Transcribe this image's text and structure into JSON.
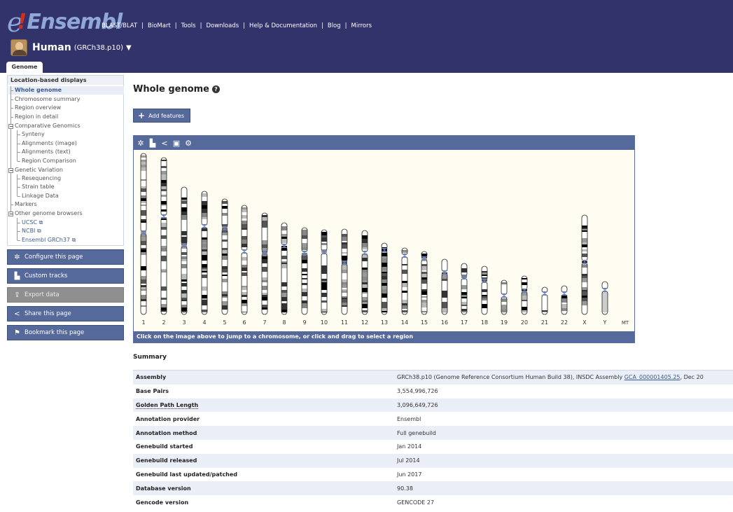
{
  "logo": {
    "e": "e",
    "bang": "!",
    "name": "Ensembl"
  },
  "top_links": [
    "BLAST/BLAT",
    "BioMart",
    "Tools",
    "Downloads",
    "Help & Documentation",
    "Blog",
    "Mirrors"
  ],
  "species": {
    "name": "Human",
    "assembly": "(GRCh38.p10)",
    "caret": "▼"
  },
  "tab": "Genome",
  "nav": {
    "header": "Location-based displays",
    "items": [
      "Whole genome",
      "Chromosome summary",
      "Region overview",
      "Region in detail",
      "Comparative Genomics",
      "Synteny",
      "Alignments (image)",
      "Alignments (text)",
      "Region Comparison",
      "Genetic Variation",
      "Resequencing",
      "Strain table",
      "Linkage Data",
      "Markers",
      "Other genome browsers",
      "UCSC",
      "NCBI",
      "Ensembl GRCh37"
    ]
  },
  "panel_buttons": [
    "Configure this page",
    "Custom tracks",
    "Export data",
    "Share this page",
    "Bookmark this page"
  ],
  "main": {
    "title": "Whole genome",
    "add_features": "Add features",
    "karyotype_footer": "Click on the image above to jump to a chromosome, or click and drag to select a region",
    "chromosomes": [
      "1",
      "2",
      "3",
      "4",
      "5",
      "6",
      "7",
      "8",
      "9",
      "10",
      "11",
      "12",
      "13",
      "14",
      "15",
      "16",
      "17",
      "18",
      "19",
      "20",
      "21",
      "22",
      "X",
      "Y"
    ],
    "mt_label": "MT"
  },
  "summary": {
    "title": "Summary",
    "rows": [
      {
        "key": "Assembly",
        "value": "GRCh38.p10 (Genome Reference Consortium Human Build 38), INSDC Assembly ",
        "link": "GCA_000001405.25",
        "suffix": ", Dec 20"
      },
      {
        "key": "Base Pairs",
        "value": "3,554,996,726"
      },
      {
        "key": "Golden Path Length",
        "value": "3,096,649,726"
      },
      {
        "key": "Annotation provider",
        "value": "Ensembl"
      },
      {
        "key": "Annotation method",
        "value": "Full genebuild"
      },
      {
        "key": "Genebuild started",
        "value": "Jan 2014"
      },
      {
        "key": "Genebuild released",
        "value": "Jul 2014"
      },
      {
        "key": "Genebuild last updated/patched",
        "value": "Jun 2017"
      },
      {
        "key": "Database version",
        "value": "90.38"
      },
      {
        "key": "Gencode version",
        "value": "GENCODE 27"
      }
    ]
  },
  "colors": {
    "masthead": "#33336b",
    "button": "#55699a",
    "link": "#3d5c8b",
    "logo_accent": "#d42f1f"
  }
}
